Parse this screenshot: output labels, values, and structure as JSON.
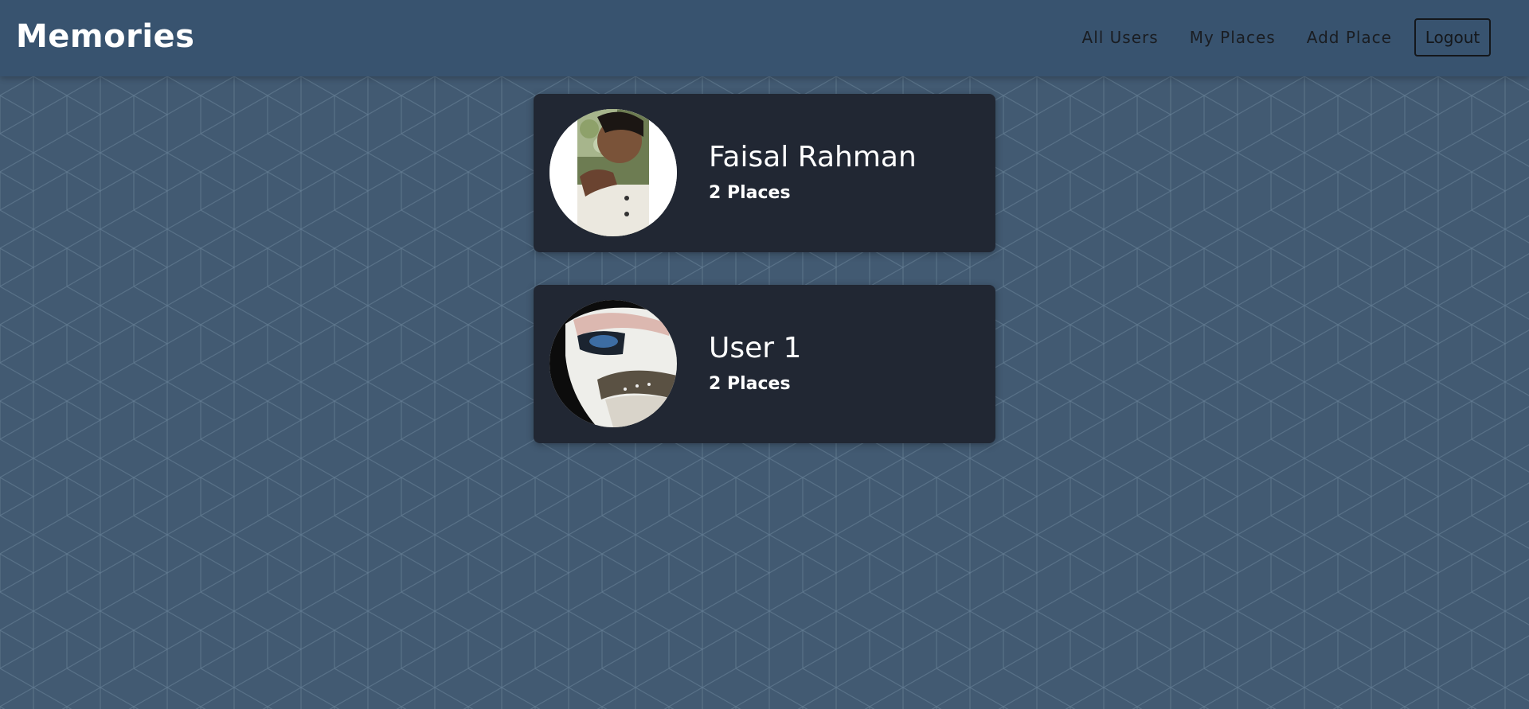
{
  "header": {
    "logo": "Memories",
    "nav": {
      "all_users": "All Users",
      "my_places": "My Places",
      "add_place": "Add Place",
      "logout": "Logout"
    }
  },
  "users": [
    {
      "name": "Faisal Rahman",
      "places": "2 Places"
    },
    {
      "name": "User 1",
      "places": "2 Places"
    }
  ],
  "colors": {
    "header": "#38536f",
    "background": "#425a72",
    "card": "#212733"
  }
}
